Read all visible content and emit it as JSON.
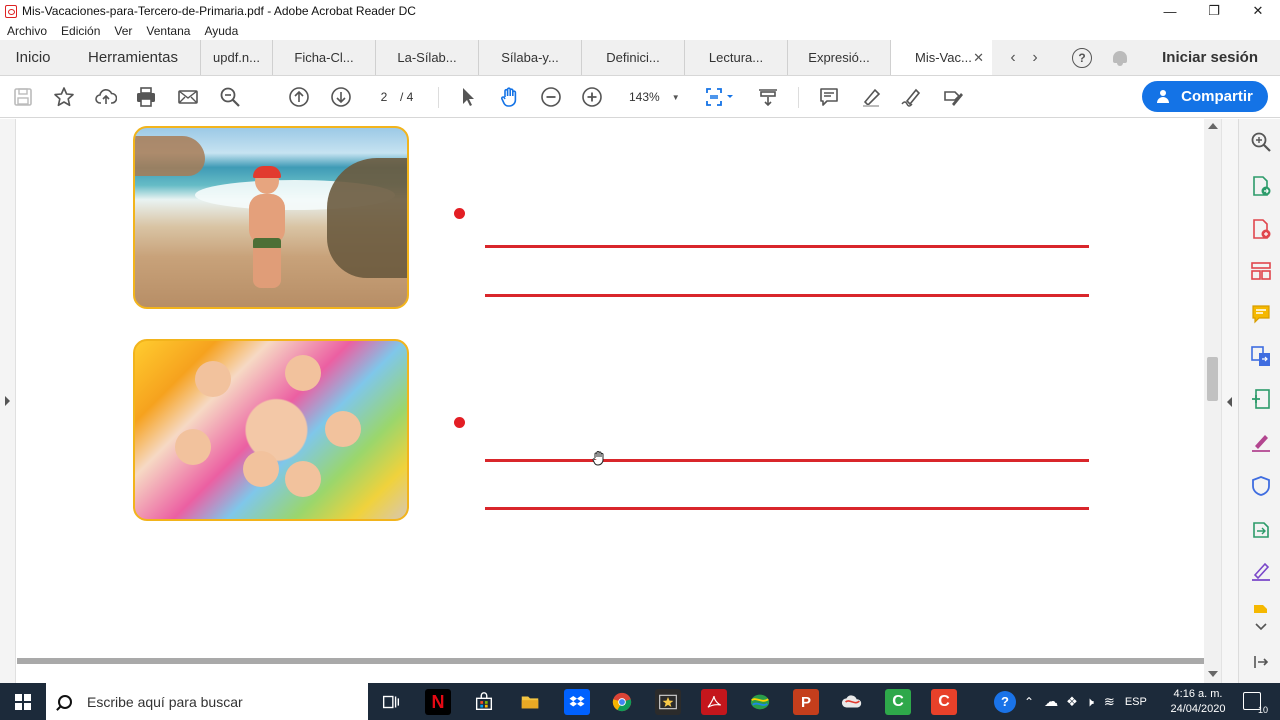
{
  "window": {
    "title": "Mis-Vacaciones-para-Tercero-de-Primaria.pdf - Adobe Acrobat Reader DC",
    "controls": {
      "minimize": "—",
      "restore": "❐",
      "close": "✕"
    }
  },
  "menu": [
    "Archivo",
    "Edición",
    "Ver",
    "Ventana",
    "Ayuda"
  ],
  "tabs": {
    "home": "Inicio",
    "tools": "Herramientas",
    "documents": [
      "updf.n...",
      "Ficha-Cl...",
      "La-Sílab...",
      "Sílaba-y...",
      "Definici...",
      "Lectura...",
      "Expresió...",
      "Mis-Vac..."
    ],
    "active_index": 7,
    "close_glyph": "✕",
    "sign_in": "Iniciar sesión"
  },
  "toolbar": {
    "page_current": "2",
    "page_total": "/ 4",
    "zoom": "143%",
    "share_label": "Compartir"
  },
  "taskbar": {
    "search_placeholder": "Escribe aquí para buscar",
    "language": "ESP",
    "time": "4:16 a. m.",
    "date": "24/04/2020",
    "notification_count": "10"
  },
  "colors": {
    "accent_blue": "#1473e6",
    "writing_line_red": "#d9262b",
    "bullet_red": "#e31e24",
    "photo_frame": "#f2b41c",
    "taskbar": "#1c2a3a"
  }
}
